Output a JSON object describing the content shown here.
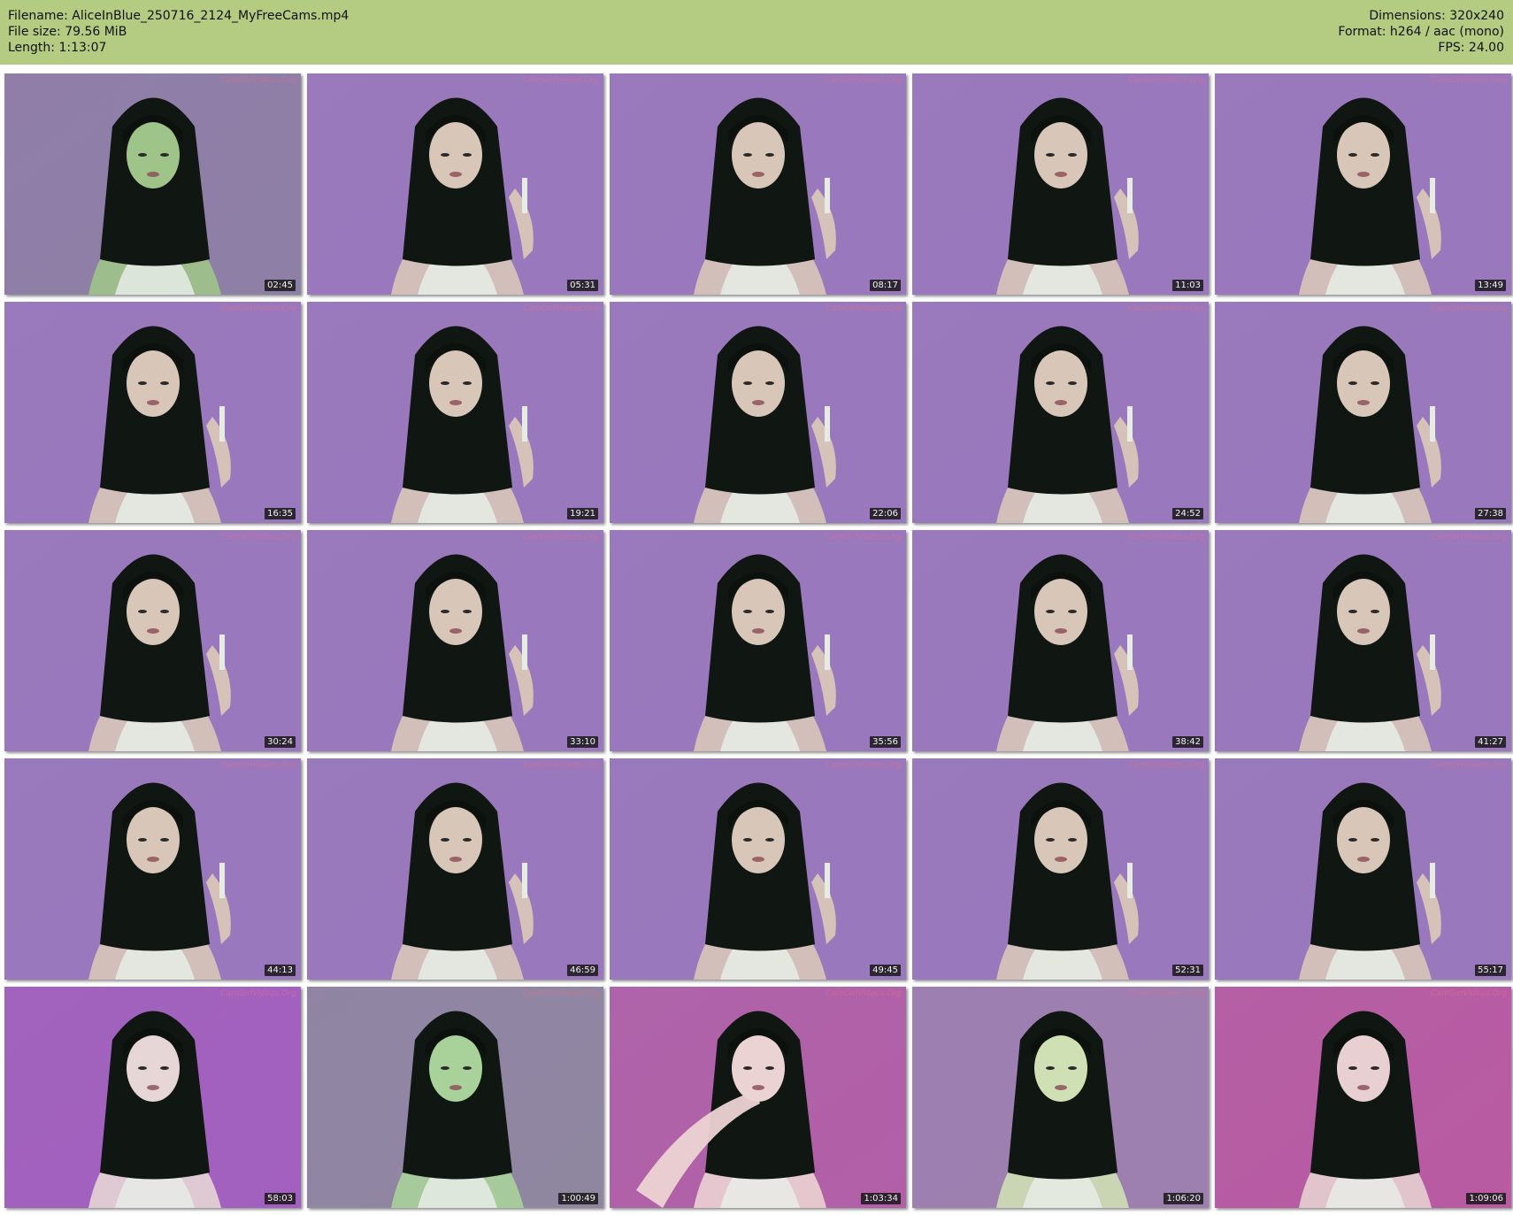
{
  "info": {
    "filename": "Filename: AliceInBlue_250716_2124_MyFreeCams.mp4",
    "filesize": "File size: 79.56 MiB",
    "length": "Length: 1:13:07",
    "dimensions": "Dimensions: 320x240",
    "format": "Format: h264 / aac (mono)",
    "fps": "FPS: 24.00"
  },
  "header_color": "#b4cc82",
  "watermark": "CamGirlVideos.Org",
  "thumbnails": [
    {
      "time": "02:45",
      "bg": "#8e7fa6",
      "tint": "#9fc48a",
      "pose": "close"
    },
    {
      "time": "05:31",
      "bg": "#9a78bd",
      "tint": "#d8c7b8",
      "pose": "strap"
    },
    {
      "time": "08:17",
      "bg": "#9a78bd",
      "tint": "#d8c7b8",
      "pose": "strap"
    },
    {
      "time": "11:03",
      "bg": "#9a78bd",
      "tint": "#d8c7b8",
      "pose": "strap"
    },
    {
      "time": "13:49",
      "bg": "#9a78bd",
      "tint": "#d8c7b8",
      "pose": "strap"
    },
    {
      "time": "16:35",
      "bg": "#9a78bd",
      "tint": "#d8c7b8",
      "pose": "strap"
    },
    {
      "time": "19:21",
      "bg": "#9a78bd",
      "tint": "#d8c7b8",
      "pose": "strap"
    },
    {
      "time": "22:06",
      "bg": "#9a78bd",
      "tint": "#d8c7b8",
      "pose": "strap"
    },
    {
      "time": "24:52",
      "bg": "#9a78bd",
      "tint": "#d8c7b8",
      "pose": "strap"
    },
    {
      "time": "27:38",
      "bg": "#9a78bd",
      "tint": "#d8c7b8",
      "pose": "strap"
    },
    {
      "time": "30:24",
      "bg": "#9a78bd",
      "tint": "#d8c7b8",
      "pose": "strap"
    },
    {
      "time": "33:10",
      "bg": "#9a78bd",
      "tint": "#d8c7b8",
      "pose": "strap"
    },
    {
      "time": "35:56",
      "bg": "#9a78bd",
      "tint": "#d8c7b8",
      "pose": "strap"
    },
    {
      "time": "38:42",
      "bg": "#9a78bd",
      "tint": "#d8c7b8",
      "pose": "strap"
    },
    {
      "time": "41:27",
      "bg": "#9a78bd",
      "tint": "#d8c7b8",
      "pose": "strap"
    },
    {
      "time": "44:13",
      "bg": "#9a78bd",
      "tint": "#d8c7b8",
      "pose": "strap"
    },
    {
      "time": "46:59",
      "bg": "#9a78bd",
      "tint": "#d8c7b8",
      "pose": "strap"
    },
    {
      "time": "49:45",
      "bg": "#9a78bd",
      "tint": "#d8c7b8",
      "pose": "strap"
    },
    {
      "time": "52:31",
      "bg": "#9a78bd",
      "tint": "#d8c7b8",
      "pose": "strap"
    },
    {
      "time": "55:17",
      "bg": "#9a78bd",
      "tint": "#d8c7b8",
      "pose": "strap"
    },
    {
      "time": "58:03",
      "bg": "#a25fbf",
      "tint": "#e6d6d6",
      "pose": "smile"
    },
    {
      "time": "1:00:49",
      "bg": "#8f86a0",
      "tint": "#a9d29a",
      "pose": "close"
    },
    {
      "time": "1:03:34",
      "bg": "#b25fa7",
      "tint": "#ecd3d3",
      "pose": "arm"
    },
    {
      "time": "1:06:20",
      "bg": "#9d7fb0",
      "tint": "#cfe0b4",
      "pose": "close"
    },
    {
      "time": "1:09:06",
      "bg": "#b95aa2",
      "tint": "#e7cfd2",
      "pose": "down"
    }
  ]
}
